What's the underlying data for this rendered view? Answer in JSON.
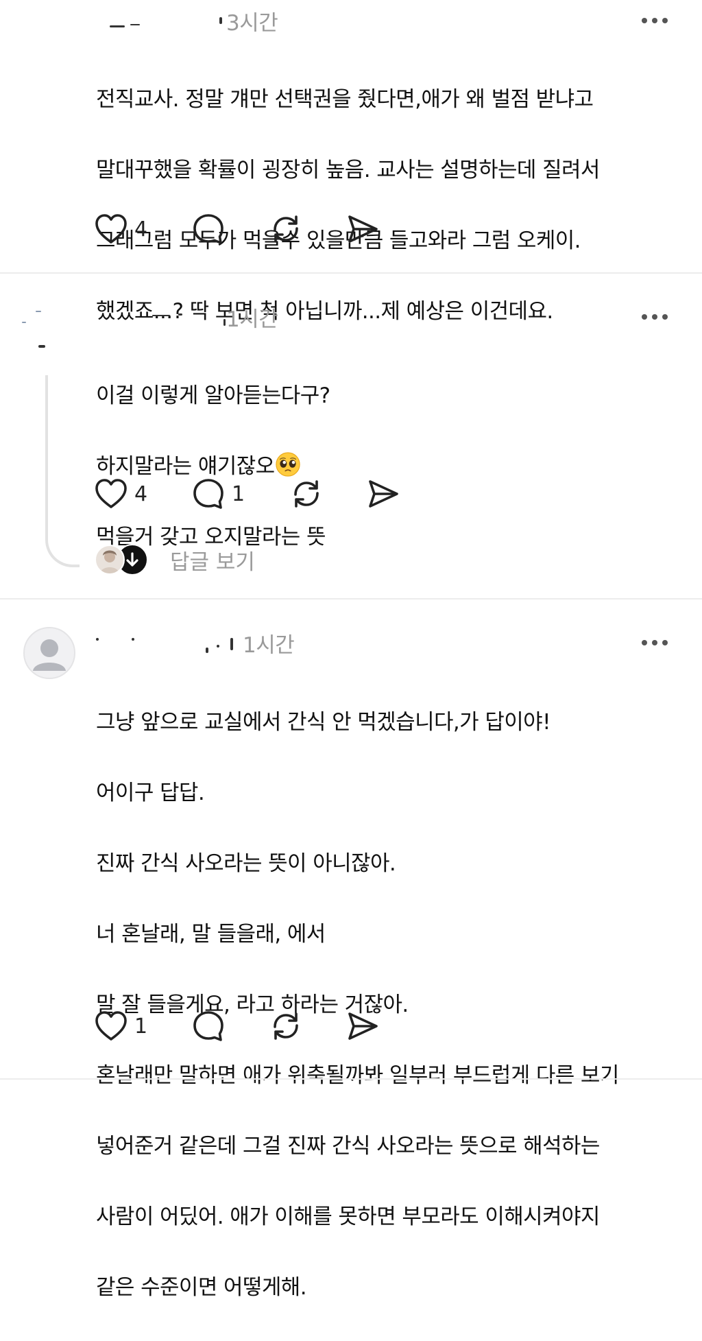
{
  "posts": [
    {
      "time": "3시간",
      "lines": [
        "전직교사. 정말 걔만 선택권을  줬다면,애가 왜 벌점 받냐고",
        "말대꾸했을 확률이 굉장히 높음. 교사는 설명하는데 질려서",
        "그래그럼 모두가 먹을수 있을만큼 들고와라 그럼 오케이.",
        "했겠죠...? 딱 보면 척 아닙니까...제 예상은 이건데요."
      ],
      "likes": "4",
      "comments": ""
    },
    {
      "time": "1시간",
      "lines": [
        "이걸 이렇게 알아듣는다구?",
        "하지말라는 얘기잖오",
        "먹을거 갖고 오지말라는 뜻"
      ],
      "likes": "4",
      "comments": "1",
      "view_replies": "답글 보기"
    },
    {
      "time": "1시간",
      "lines": [
        "그냥 앞으로 교실에서 간식 안 먹겠습니다,가 답이야!",
        "어이구 답답.",
        "진짜 간식 사오라는 뜻이 아니잖아.",
        "너 혼날래, 말 들을래, 에서",
        "말 잘 들을게요, 라고 하라는 거잖아.",
        "혼날래만 말하면 애가 위축될까봐 일부러 부드럽게 다른 보기",
        "넣어준거 같은데 그걸 진짜 간식 사오라는 뜻으로 해석하는",
        "사람이 어딨어. 애가 이해를 못하면 부모라도 이해시켜야지",
        "같은 수준이면 어떻게해."
      ],
      "likes": "1",
      "comments": ""
    }
  ],
  "icons": {
    "like": "heart-icon",
    "comment": "comment-bubble-icon",
    "repost": "repost-icon",
    "share": "send-icon",
    "more": "more-dots-icon",
    "emoji": "pleading-face-emoji",
    "avatar": "default-avatar-icon",
    "arrow": "arrow-down-icon"
  },
  "colors": {
    "text": "#111111",
    "muted": "#9a9a9a",
    "divider": "#ececec"
  }
}
